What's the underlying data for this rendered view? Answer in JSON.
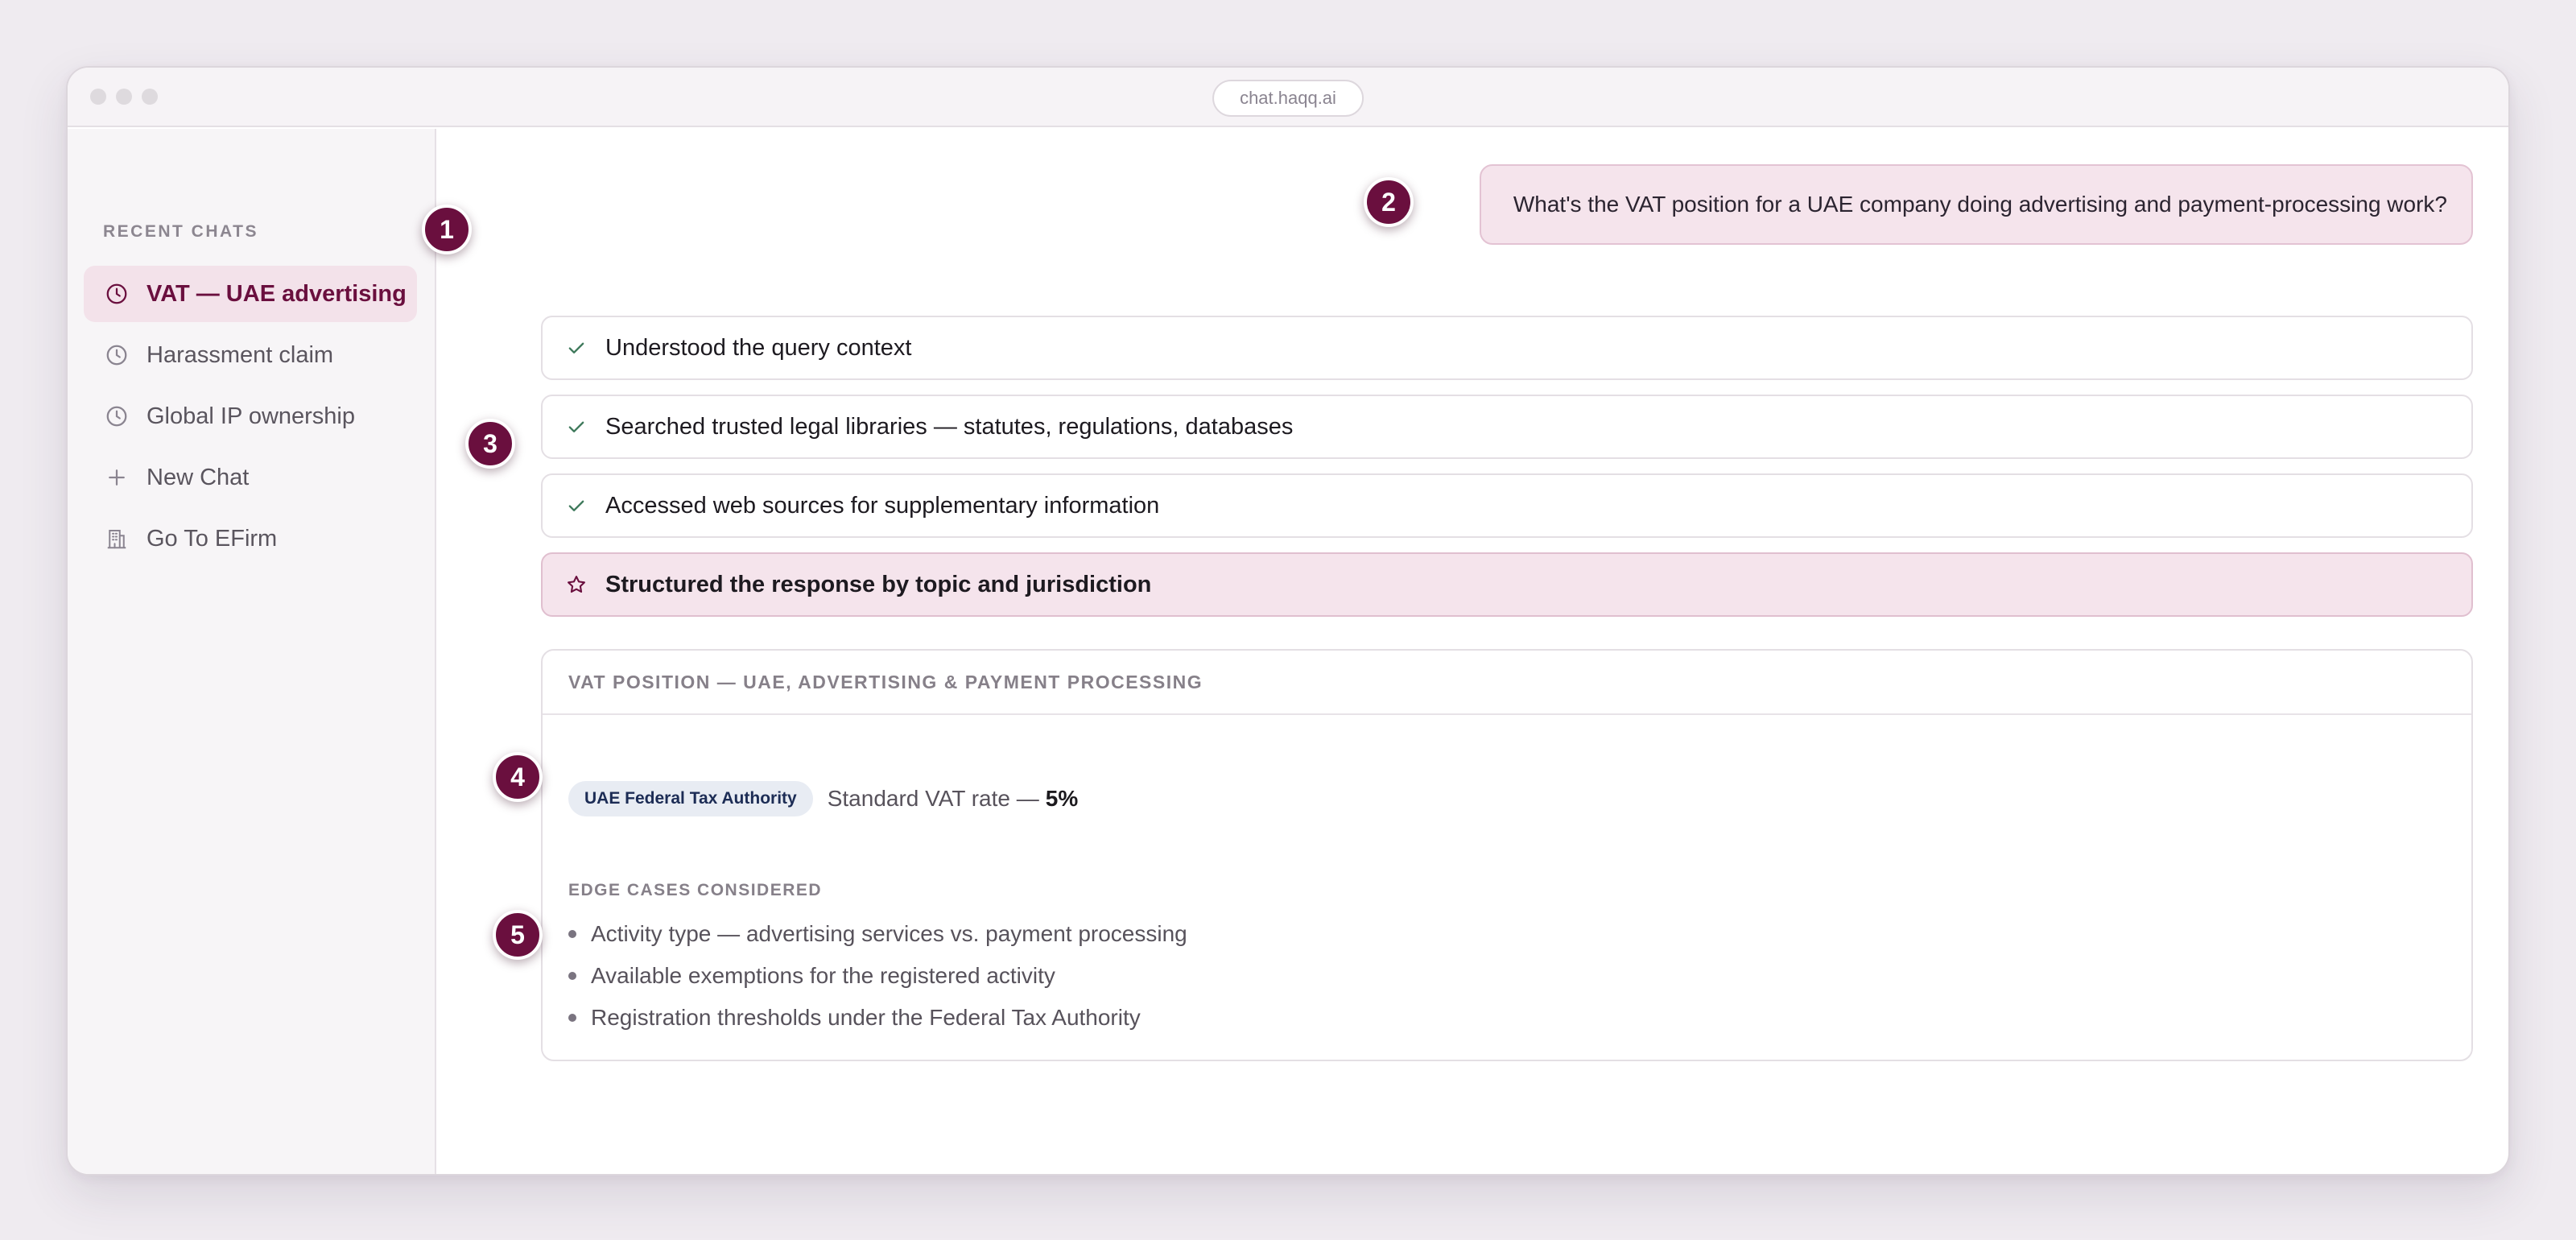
{
  "browser": {
    "url": "chat.haqq.ai"
  },
  "sidebar": {
    "heading": "RECENT CHATS",
    "items": [
      {
        "label": "VAT — UAE advertising",
        "icon": "clock-icon",
        "active": true
      },
      {
        "label": "Harassment claim",
        "icon": "clock-icon",
        "active": false
      },
      {
        "label": "Global IP ownership",
        "icon": "clock-icon",
        "active": false
      },
      {
        "label": "New Chat",
        "icon": "plus-icon",
        "active": false
      },
      {
        "label": "Go To EFirm",
        "icon": "building-icon",
        "active": false
      }
    ]
  },
  "callouts": [
    "1",
    "2",
    "3",
    "4",
    "5"
  ],
  "chat": {
    "user_message": "What's the VAT position for a UAE company doing advertising and payment-processing work?",
    "steps": [
      {
        "label": "Understood the query context",
        "icon": "check-icon",
        "status": "done"
      },
      {
        "label": "Searched trusted legal libraries — statutes, regulations, databases",
        "icon": "check-icon",
        "status": "done"
      },
      {
        "label": "Accessed web sources for supplementary information",
        "icon": "check-icon",
        "status": "done"
      },
      {
        "label": "Structured the response by topic and jurisdiction",
        "icon": "star-icon",
        "status": "active"
      }
    ]
  },
  "answer": {
    "title": "VAT POSITION — UAE, ADVERTISING & PAYMENT PROCESSING",
    "authority_chip": "UAE Federal Tax Authority",
    "rate_label": "Standard VAT rate —",
    "rate_value": "5%",
    "edge_heading": "EDGE CASES CONSIDERED",
    "edge_cases": [
      "Activity type — advertising services vs. payment processing",
      "Available exemptions for the registered activity",
      "Registration thresholds under the Federal Tax Authority"
    ]
  },
  "colors": {
    "accent": "#6a0f3e",
    "active_bg": "#f5e4ec",
    "check": "#3f7a5c",
    "chip_bg": "#e8ecf3",
    "chip_text": "#1c2c55"
  }
}
